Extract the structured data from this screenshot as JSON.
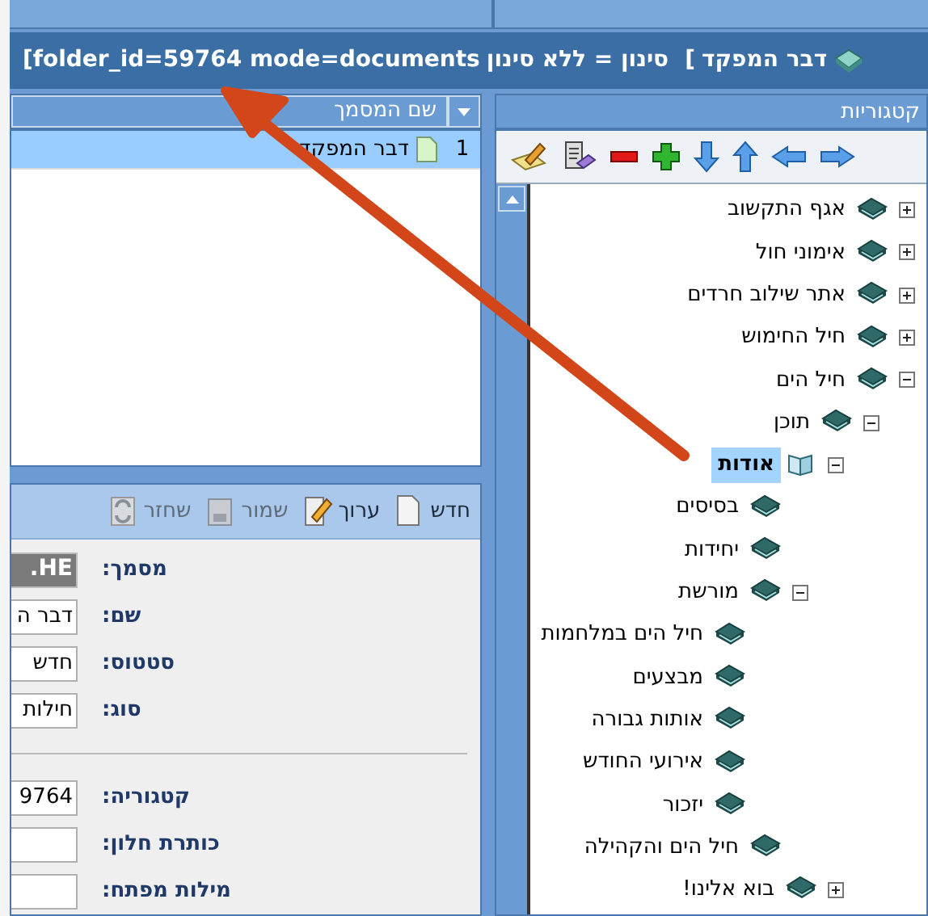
{
  "title_bar": {
    "params": "[folder_id=59764 mode=documents",
    "filter": "סינון = ללא סינון",
    "bracket": "[",
    "document": "דבר המפקד"
  },
  "documents_panel": {
    "column": "שם המסמך",
    "rows": [
      {
        "number": "1",
        "name": "דבר המפקד",
        "selected": true
      }
    ]
  },
  "document_toolbar": [
    {
      "label": "חדש",
      "disabled": false
    },
    {
      "label": "ערוך",
      "disabled": false
    },
    {
      "label": "שמור",
      "disabled": true
    },
    {
      "label": "שחזר",
      "disabled": true
    }
  ],
  "form": [
    {
      "label": "מסמך:",
      "value": ".HE",
      "readonly": true
    },
    {
      "label": "שם:",
      "value": "דבר ה",
      "readonly": false
    },
    {
      "label": "סטטוס:",
      "value": "חדש",
      "readonly": false
    },
    {
      "label": "סוג:",
      "value": "חילות",
      "readonly": false
    },
    {
      "kind": "divider"
    },
    {
      "label": "קטגוריה:",
      "value": "9764",
      "readonly": false
    },
    {
      "label": "כותרת חלון:",
      "readonly": false
    },
    {
      "label": "מילות מפתח:",
      "readonly": false
    }
  ],
  "categories_panel": {
    "title": "קטגוריות",
    "tree": [
      {
        "label": "אגף התקשוב",
        "expanded": false,
        "selected": false
      },
      {
        "label": "אימוני חול",
        "expanded": false,
        "selected": false
      },
      {
        "label": "אתר שילוב חרדים",
        "expanded": false,
        "selected": false
      },
      {
        "label": "חיל החימוש",
        "expanded": false,
        "selected": false
      },
      {
        "label": "חיל הים",
        "expanded": true,
        "selected": false,
        "children": [
          {
            "label": "תוכן",
            "expanded": true,
            "selected": false,
            "children": [
              {
                "label": "אודות",
                "expanded": true,
                "selected": true,
                "children": [
                  {
                    "label": "בסיסים",
                    "selected": false
                  },
                  {
                    "label": "יחידות",
                    "selected": false
                  },
                  {
                    "label": "מורשת",
                    "expanded": true,
                    "selected": false,
                    "children": [
                      {
                        "label": "חיל הים במלחמות",
                        "selected": false
                      },
                      {
                        "label": "מבצעים",
                        "selected": false
                      },
                      {
                        "label": "אותות גבורה",
                        "selected": false
                      },
                      {
                        "label": "אירועי החודש",
                        "selected": false
                      },
                      {
                        "label": "יזכור",
                        "selected": false
                      }
                    ]
                  },
                  {
                    "label": "חיל הים והקהילה",
                    "selected": false
                  }
                ]
              },
              {
                "label": "בוא אלינו!",
                "expanded": false,
                "selected": false
              }
            ]
          }
        ]
      }
    ]
  }
}
